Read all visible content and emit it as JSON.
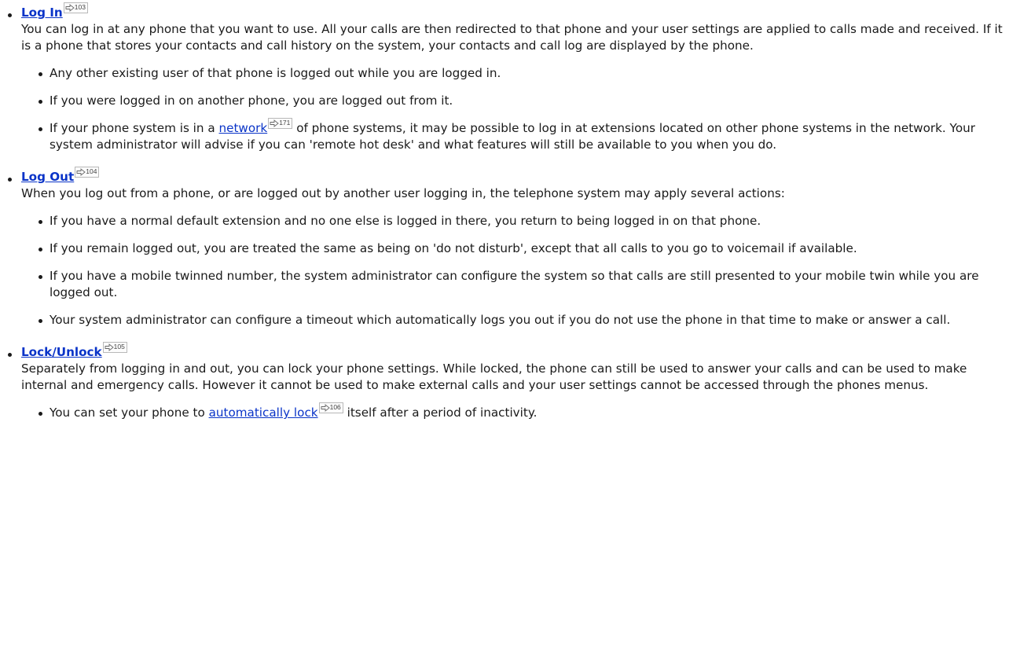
{
  "sections": [
    {
      "title": "Log In",
      "ref": "103",
      "description": "You can log in at any phone that you want to use. All your calls are then redirected to that phone and your user settings are applied to calls made and received. If it is a phone that stores your contacts and call history on the system, your contacts and call log are displayed by the phone.",
      "bullets": [
        "Any other existing user of that phone is logged out while you are logged in.",
        "If you were logged in on another phone, you are logged out from it."
      ],
      "network_bullet": {
        "before": "If your phone system is in a ",
        "link": "network",
        "ref": "171",
        "after": " of phone systems, it may be possible to log in at extensions located on other phone systems in the network. Your system administrator will advise if you can 'remote hot desk' and what features will still be available to you when you do."
      }
    },
    {
      "title": "Log Out",
      "ref": "104",
      "description": "When you log out from a phone, or are logged out by another user logging in, the telephone system may apply several actions:",
      "bullets": [
        "If you have a normal default extension and no one else is logged in there, you return to being logged in on that phone.",
        "If you remain logged out, you are treated the same as being on 'do not disturb', except that all calls to you go to voicemail if available.",
        "If you have a mobile twinned number, the system administrator can configure the system so that calls are still presented to your mobile twin while you are logged out.",
        "Your system administrator can configure a timeout which automatically logs you out if you do not use the phone in that time to make or answer a call."
      ]
    },
    {
      "title": "Lock/Unlock",
      "ref": "105",
      "description": "Separately from logging in and out, you can lock your phone settings. While locked, the phone can still be used to answer your calls and can be used to make internal and emergency calls. However it cannot be used to make external calls and your user settings cannot be accessed through the phones menus.",
      "lock_bullet": {
        "before": "You can set your phone to ",
        "link": "automatically lock",
        "ref": "106",
        "after": " itself after a period of inactivity."
      }
    }
  ],
  "icons": {
    "xref": "cross-reference-arrow-icon"
  },
  "colors": {
    "link": "#0a34c8",
    "text": "#1a1a1a"
  }
}
